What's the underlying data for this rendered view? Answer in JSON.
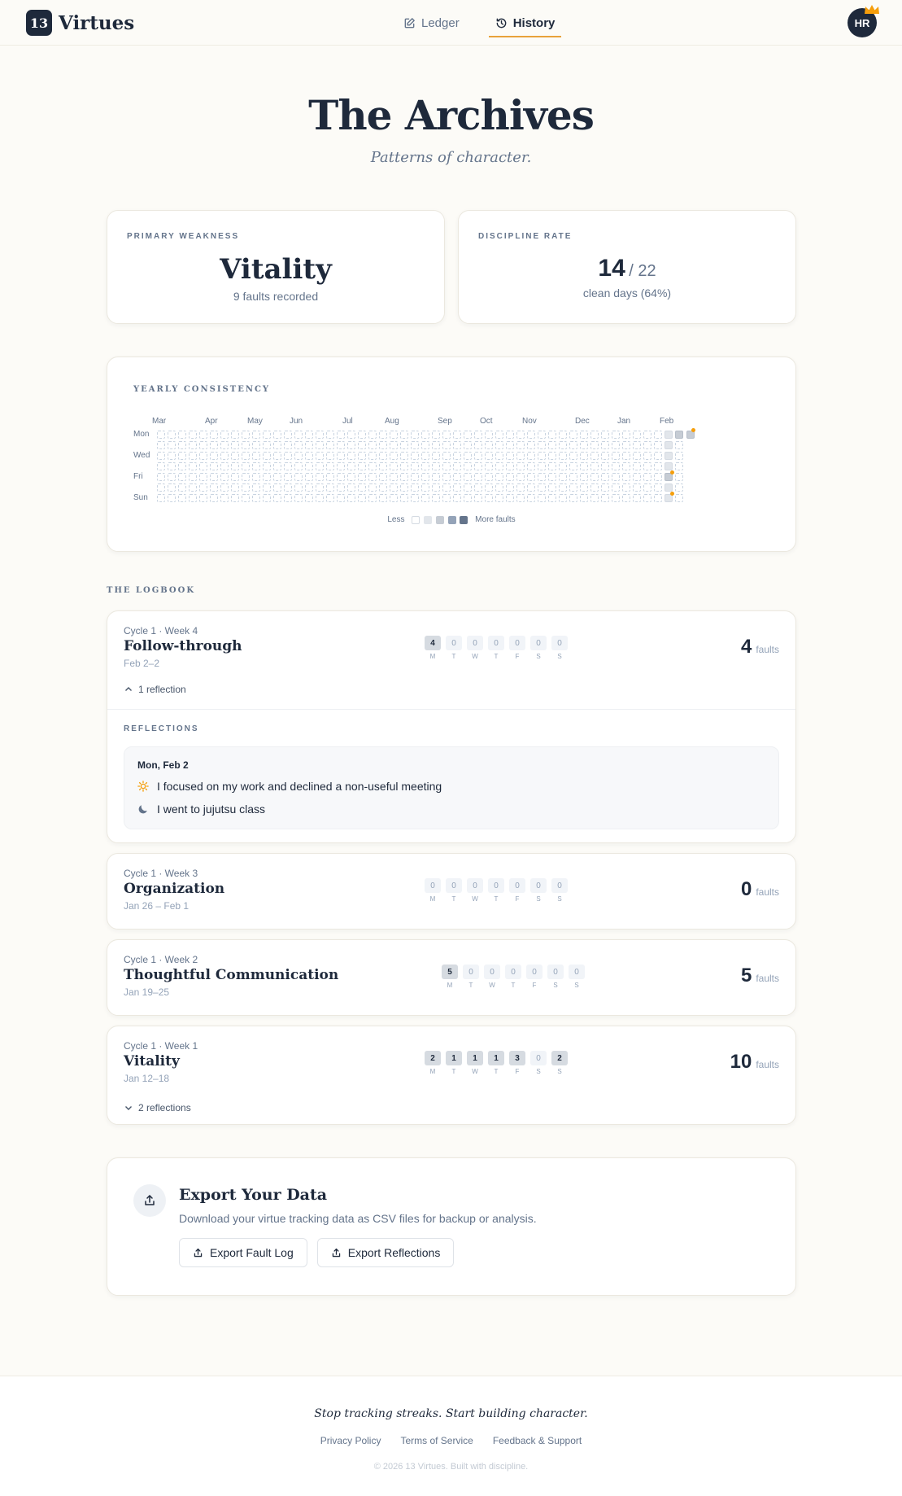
{
  "header": {
    "brand_badge": "13",
    "brand_name": "Virtues",
    "nav": [
      {
        "label": "Ledger",
        "icon": "edit-icon",
        "active": false
      },
      {
        "label": "History",
        "icon": "history-icon",
        "active": true
      }
    ],
    "avatar_initials": "HR"
  },
  "hero": {
    "title": "The Archives",
    "subtitle": "Patterns of character."
  },
  "stats": {
    "weakness": {
      "label": "PRIMARY WEAKNESS",
      "value": "Vitality",
      "note": "9 faults recorded"
    },
    "discipline": {
      "label": "DISCIPLINE RATE",
      "value": "14",
      "total": "/ 22",
      "note": "clean days (64%)"
    }
  },
  "heatmap": {
    "label": "YEARLY CONSISTENCY",
    "months": [
      "Mar",
      "Apr",
      "May",
      "Jun",
      "Jul",
      "Aug",
      "Sep",
      "Oct",
      "Nov",
      "Dec",
      "Jan",
      "Feb"
    ],
    "month_week_index": [
      0,
      5,
      9,
      13,
      18,
      22,
      27,
      31,
      35,
      40,
      44,
      48
    ],
    "day_labels": [
      "Mon",
      "Wed",
      "Fri",
      "Sun"
    ],
    "weeks": 50,
    "current_week_start": 48,
    "legend_less": "Less",
    "legend_more": "More faults",
    "legend_colors": [
      "#ffffff",
      "#e2e6eb",
      "#c6ccd4",
      "#94a3b8",
      "#64748b"
    ],
    "accent": "#f59e0b"
  },
  "logbook": {
    "label": "THE LOGBOOK",
    "weeks": [
      {
        "meta": "Cycle 1 · Week 4",
        "title": "Follow-through",
        "dates": "Feb 2–2",
        "days": [
          4,
          0,
          0,
          0,
          0,
          0,
          0
        ],
        "faults": "4",
        "faults_unit": "faults",
        "toggle": "1 reflection",
        "expanded": true
      },
      {
        "meta": "Cycle 1 · Week 3",
        "title": "Organization",
        "dates": "Jan 26 – Feb 1",
        "days": [
          0,
          0,
          0,
          0,
          0,
          0,
          0
        ],
        "faults": "0",
        "faults_unit": "faults"
      },
      {
        "meta": "Cycle 1 · Week 2",
        "title": "Thoughtful Communication",
        "dates": "Jan 19–25",
        "days": [
          5,
          0,
          0,
          0,
          0,
          0,
          0
        ],
        "faults": "5",
        "faults_unit": "faults"
      },
      {
        "meta": "Cycle 1 · Week 1",
        "title": "Vitality",
        "dates": "Jan 12–18",
        "days": [
          2,
          1,
          1,
          1,
          3,
          0,
          2
        ],
        "faults": "10",
        "faults_unit": "faults",
        "toggle": "2 reflections",
        "expanded": false
      }
    ],
    "day_letters": [
      "M",
      "T",
      "W",
      "T",
      "F",
      "S",
      "S"
    ],
    "reflections": {
      "label": "REFLECTIONS",
      "date": "Mon, Feb 2",
      "morning": "I focused on my work and declined a non-useful meeting",
      "evening": "I went to jujutsu class"
    }
  },
  "export": {
    "title": "Export Your Data",
    "description": "Download your virtue tracking data as CSV files for backup or analysis.",
    "fault_button": "Export Fault Log",
    "reflection_button": "Export Reflections"
  },
  "footer": {
    "tagline": "Stop tracking streaks. Start building character.",
    "links": [
      "Privacy Policy",
      "Terms of Service",
      "Feedback & Support"
    ],
    "copyright": "© 2026 13 Virtues. Built with discipline."
  }
}
